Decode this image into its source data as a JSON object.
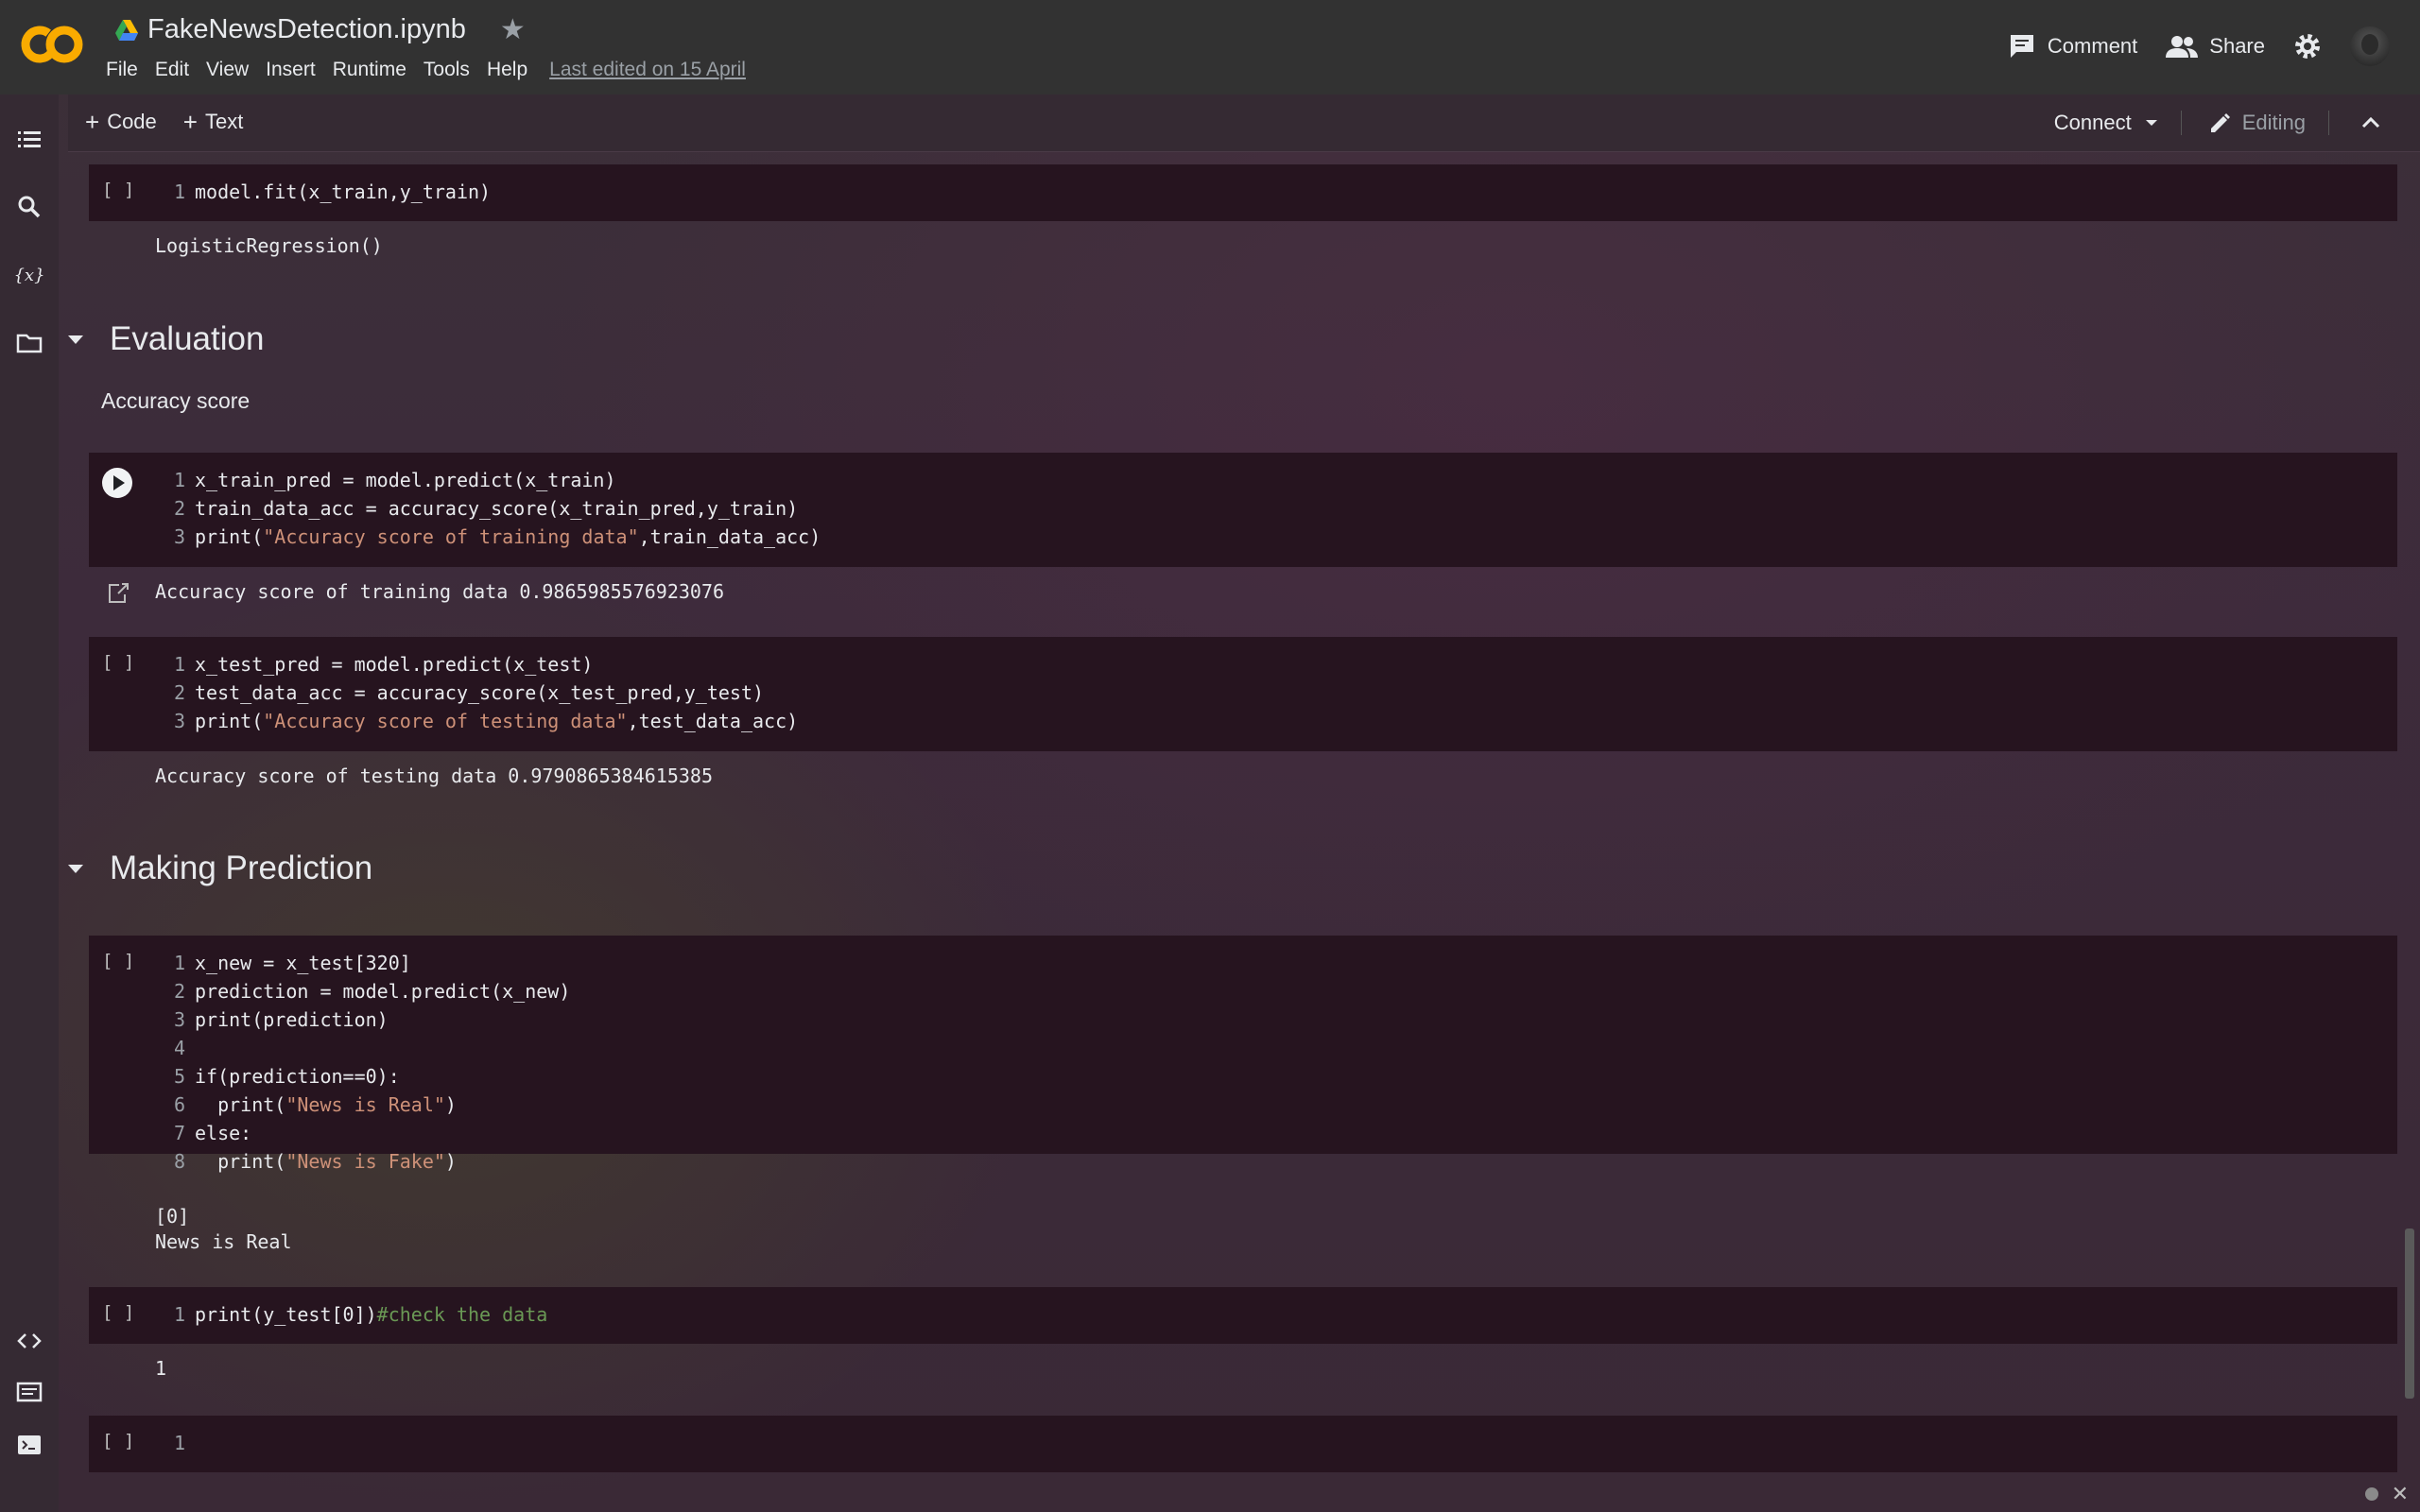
{
  "header": {
    "doc_name": "FakeNewsDetection.ipynb",
    "menu": [
      "File",
      "Edit",
      "View",
      "Insert",
      "Runtime",
      "Tools",
      "Help"
    ],
    "last_edited": "Last edited on 15 April",
    "comment_label": "Comment",
    "share_label": "Share"
  },
  "toolbar": {
    "add_code": "Code",
    "add_text": "Text",
    "connect": "Connect",
    "editing": "Editing"
  },
  "cells": {
    "fit": {
      "run": "[ ]",
      "lines": [
        {
          "n": "1",
          "code": "model.fit(x_train,y_train)"
        }
      ],
      "output": "LogisticRegression()"
    },
    "evaluation": {
      "heading": "Evaluation",
      "text": "Accuracy score"
    },
    "train_acc": {
      "lines": [
        {
          "n": "1",
          "code": "x_train_pred = model.predict(x_train)"
        },
        {
          "n": "2",
          "code": "train_data_acc = accuracy_score(x_train_pred,y_train)"
        },
        {
          "n": "3",
          "pre": "print(",
          "str": "\"Accuracy score of training data\"",
          "post": ",train_data_acc)"
        }
      ],
      "output": "Accuracy score of training data 0.9865985576923076"
    },
    "test_acc": {
      "run": "[ ]",
      "lines": [
        {
          "n": "1",
          "code": "x_test_pred = model.predict(x_test)"
        },
        {
          "n": "2",
          "code": "test_data_acc = accuracy_score(x_test_pred,y_test)"
        },
        {
          "n": "3",
          "pre": "print(",
          "str": "\"Accuracy score of testing data\"",
          "post": ",test_data_acc)"
        }
      ],
      "output": "Accuracy score of testing data 0.9790865384615385"
    },
    "prediction": {
      "heading": "Making Prediction",
      "run": "[ ]",
      "lines": [
        {
          "n": "1",
          "code": "x_new = x_test[320]"
        },
        {
          "n": "2",
          "code": "prediction = model.predict(x_new)"
        },
        {
          "n": "3",
          "code": "print(prediction)"
        },
        {
          "n": "4",
          "code": ""
        },
        {
          "n": "5",
          "code": "if(prediction==0):"
        },
        {
          "n": "6",
          "pre": "  print(",
          "str": "\"News is Real\"",
          "post": ")"
        },
        {
          "n": "7",
          "code": "else:"
        },
        {
          "n": "8",
          "pre": "  print(",
          "str": "\"News is Fake\"",
          "post": ")"
        }
      ],
      "output_1": "[0]",
      "output_2": "News is Real"
    },
    "check": {
      "run": "[ ]",
      "lines": [
        {
          "n": "1",
          "pre": "print(y_test[0])",
          "cmt": "#check the data"
        }
      ],
      "output": "1"
    },
    "empty": {
      "run": "[ ]",
      "lines": [
        {
          "n": "1",
          "code": ""
        }
      ]
    }
  },
  "colors": {
    "cell_bg": "#26141f",
    "string": "#ce9178",
    "comment": "#6a9955"
  }
}
